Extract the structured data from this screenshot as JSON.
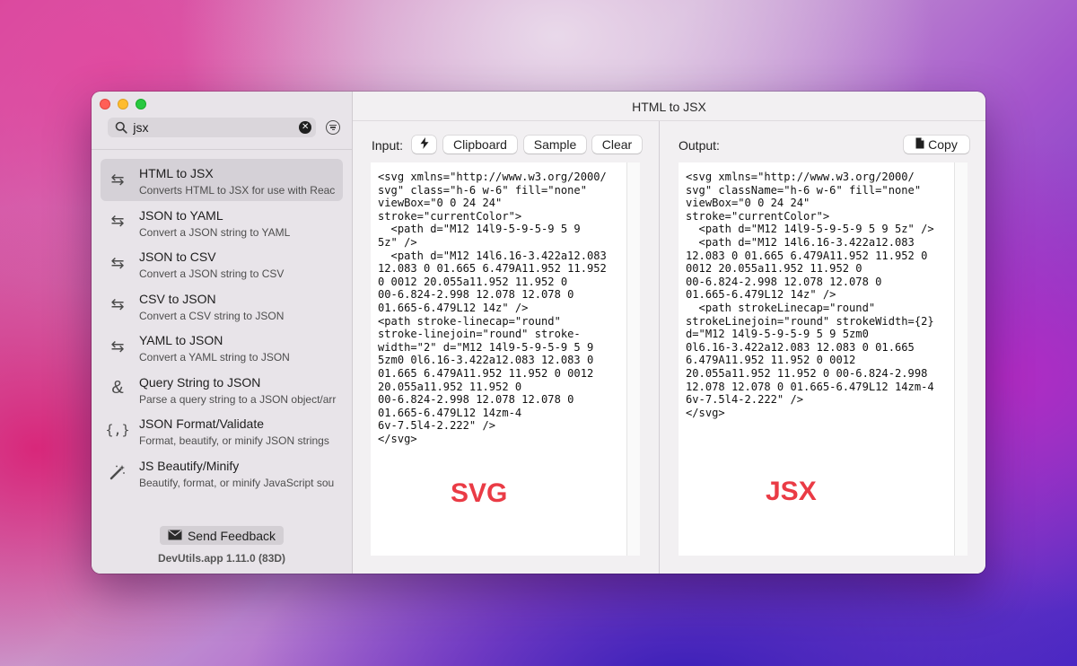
{
  "window": {
    "title": "HTML to JSX"
  },
  "search": {
    "value": "jsx",
    "placeholder": "Search"
  },
  "sidebar": {
    "items": [
      {
        "icon": "convert-arrows-icon",
        "title": "HTML to JSX",
        "desc": "Converts HTML to JSX for use with Reac"
      },
      {
        "icon": "convert-arrows-icon",
        "title": "JSON to YAML",
        "desc": "Convert a JSON string to YAML"
      },
      {
        "icon": "convert-arrows-icon",
        "title": "JSON to CSV",
        "desc": "Convert a JSON string to CSV"
      },
      {
        "icon": "convert-arrows-icon",
        "title": "CSV to JSON",
        "desc": "Convert a CSV string to JSON"
      },
      {
        "icon": "convert-arrows-icon",
        "title": "YAML to JSON",
        "desc": "Convert a YAML string to JSON"
      },
      {
        "icon": "ampersand-icon",
        "title": "Query String to JSON",
        "desc": "Parse a query string to a JSON object/arr"
      },
      {
        "icon": "curly-braces-icon",
        "title": "JSON Format/Validate",
        "desc": "Format, beautify, or minify JSON strings"
      },
      {
        "icon": "magic-wand-icon",
        "title": "JS Beautify/Minify",
        "desc": "Beautify, format, or minify JavaScript sou"
      }
    ],
    "feedback_label": "Send Feedback",
    "version": "DevUtils.app 1.11.0 (83D)"
  },
  "input": {
    "label": "Input:",
    "clipboard_label": "Clipboard",
    "sample_label": "Sample",
    "clear_label": "Clear",
    "text": "<svg xmlns=\"http://www.w3.org/2000/\nsvg\" class=\"h-6 w-6\" fill=\"none\"\nviewBox=\"0 0 24 24\"\nstroke=\"currentColor\">\n  <path d=\"M12 14l9-5-9-5-9 5 9\n5z\" />\n  <path d=\"M12 14l6.16-3.422a12.083\n12.083 0 01.665 6.479A11.952 11.952\n0 0012 20.055a11.952 11.952 0\n00-6.824-2.998 12.078 12.078 0\n01.665-6.479L12 14z\" />\n<path stroke-linecap=\"round\"\nstroke-linejoin=\"round\" stroke-\nwidth=\"2\" d=\"M12 14l9-5-9-5-9 5 9\n5zm0 0l6.16-3.422a12.083 12.083 0\n01.665 6.479A11.952 11.952 0 0012\n20.055a11.952 11.952 0\n00-6.824-2.998 12.078 12.078 0\n01.665-6.479L12 14zm-4\n6v-7.5l4-2.222\" />\n</svg>",
    "annotation": "SVG"
  },
  "output": {
    "label": "Output:",
    "copy_label": "Copy",
    "text": "<svg xmlns=\"http://www.w3.org/2000/\nsvg\" className=\"h-6 w-6\" fill=\"none\"\nviewBox=\"0 0 24 24\"\nstroke=\"currentColor\">\n  <path d=\"M12 14l9-5-9-5-9 5 9 5z\" />\n  <path d=\"M12 14l6.16-3.422a12.083\n12.083 0 01.665 6.479A11.952 11.952 0\n0012 20.055a11.952 11.952 0\n00-6.824-2.998 12.078 12.078 0\n01.665-6.479L12 14z\" />\n  <path strokeLinecap=\"round\"\nstrokeLinejoin=\"round\" strokeWidth={2}\nd=\"M12 14l9-5-9-5-9 5 9 5zm0\n0l6.16-3.422a12.083 12.083 0 01.665\n6.479A11.952 11.952 0 0012\n20.055a11.952 11.952 0 00-6.824-2.998\n12.078 12.078 0 01.665-6.479L12 14zm-4\n6v-7.5l4-2.222\" />\n</svg>",
    "annotation": "JSX"
  }
}
